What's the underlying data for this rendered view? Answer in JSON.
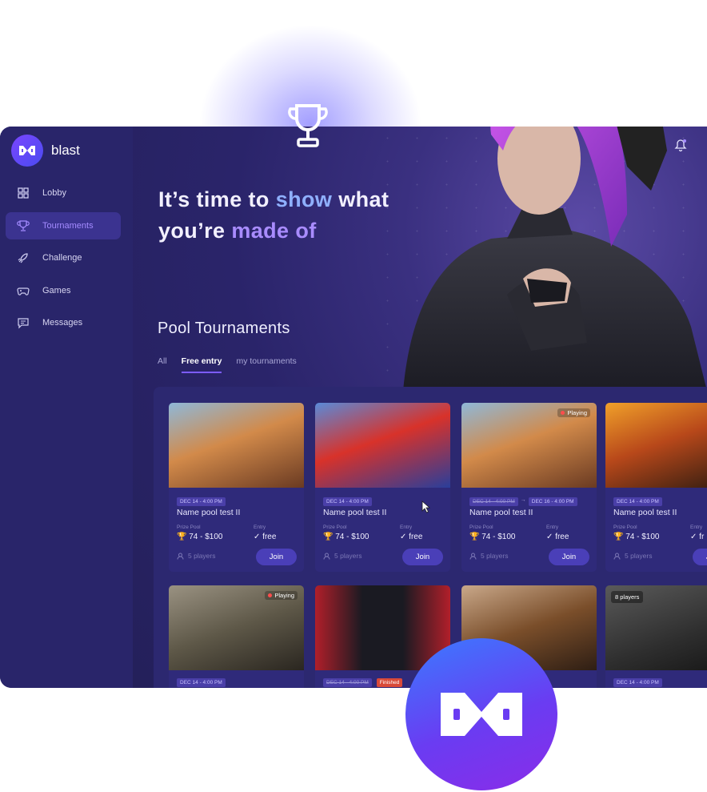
{
  "brand": {
    "name": "blast",
    "logo_icon": "blast-logo-icon"
  },
  "sidebar": {
    "items": [
      {
        "label": "Lobby",
        "icon": "grid-icon",
        "active": false
      },
      {
        "label": "Tournaments",
        "icon": "trophy-icon",
        "active": true
      },
      {
        "label": "Challenge",
        "icon": "rocket-icon",
        "active": false
      },
      {
        "label": "Games",
        "icon": "gamepad-icon",
        "active": false
      },
      {
        "label": "Messages",
        "icon": "message-icon",
        "active": false
      }
    ]
  },
  "hero": {
    "line1_a": "It’s time to ",
    "line1_b": "show",
    "line1_c": " what",
    "line2_a": "you’re ",
    "line2_b": "made of"
  },
  "section": {
    "title": "Pool Tournaments"
  },
  "tabs": [
    {
      "label": "All",
      "active": false
    },
    {
      "label": "Free entry",
      "active": true
    },
    {
      "label": "my tournaments",
      "active": false
    }
  ],
  "card_labels": {
    "prize": "Prize Pool",
    "entry": "Entry",
    "join": "Join"
  },
  "cards_row1": [
    {
      "date": "DEC 14 - 4:00 PM",
      "name": "Name pool test II",
      "prize": "74 - $100",
      "entry": "free",
      "players": "5 players",
      "status": "",
      "theme": "#c9763a"
    },
    {
      "date": "DEC 14 - 4:00 PM",
      "name": "Name pool test II",
      "prize": "74 - $100",
      "entry": "free",
      "players": "5 players",
      "status": "",
      "theme": "#d8322a"
    },
    {
      "date": "DEC 14 - 4:00 PM",
      "date2": "DEC 16 - 4:00 PM",
      "name": "Name pool test II",
      "prize": "74 - $100",
      "entry": "free",
      "players": "5 players",
      "status": "Playing",
      "theme": "#c9763a"
    },
    {
      "date": "DEC 14 - 4:00 PM",
      "name": "Name pool test II",
      "prize": "74 - $100",
      "entry": "fr",
      "players": "5 players",
      "status": "",
      "theme": "#b8481a"
    }
  ],
  "cards_row2": [
    {
      "date": "DEC 14 - 4:00 PM",
      "status": "Playing",
      "theme": "#6b6450"
    },
    {
      "date": "DEC 14 - 4:00 PM",
      "status": "Finished",
      "theme": "#b11f2a"
    },
    {
      "date": "",
      "status": "",
      "theme": "#7a4e2a"
    },
    {
      "date": "DEC 14 - 4:00 PM",
      "status": "8 players",
      "theme": "#3a3a3a"
    }
  ],
  "colors": {
    "accent": "#7c5cff",
    "sidebar": "#29256a",
    "main": "#24205a",
    "badge_top": "#3a7bff",
    "badge_bottom": "#8a2ce8"
  }
}
